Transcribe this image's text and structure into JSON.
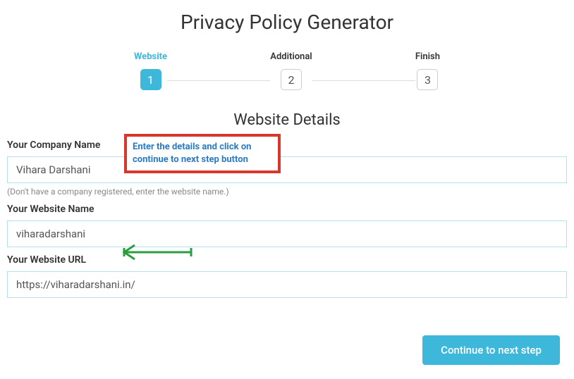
{
  "page_title": "Privacy Policy Generator",
  "stepper": {
    "steps": [
      {
        "label": "Website",
        "number": "1",
        "active": true
      },
      {
        "label": "Additional",
        "number": "2",
        "active": false
      },
      {
        "label": "Finish",
        "number": "3",
        "active": false
      }
    ]
  },
  "section_title": "Website Details",
  "callout": {
    "text": "Enter the details and click on continue to next step button"
  },
  "form": {
    "company_name": {
      "label": "Your Company Name",
      "value": "Vihara Darshani",
      "hint": "(Don't have a company registered, enter the website name.)"
    },
    "website_name": {
      "label": "Your Website Name",
      "value": "viharadarshani"
    },
    "website_url": {
      "label": "Your Website URL",
      "value": "https://viharadarshani.in/"
    }
  },
  "continue_button": "Continue to next step"
}
